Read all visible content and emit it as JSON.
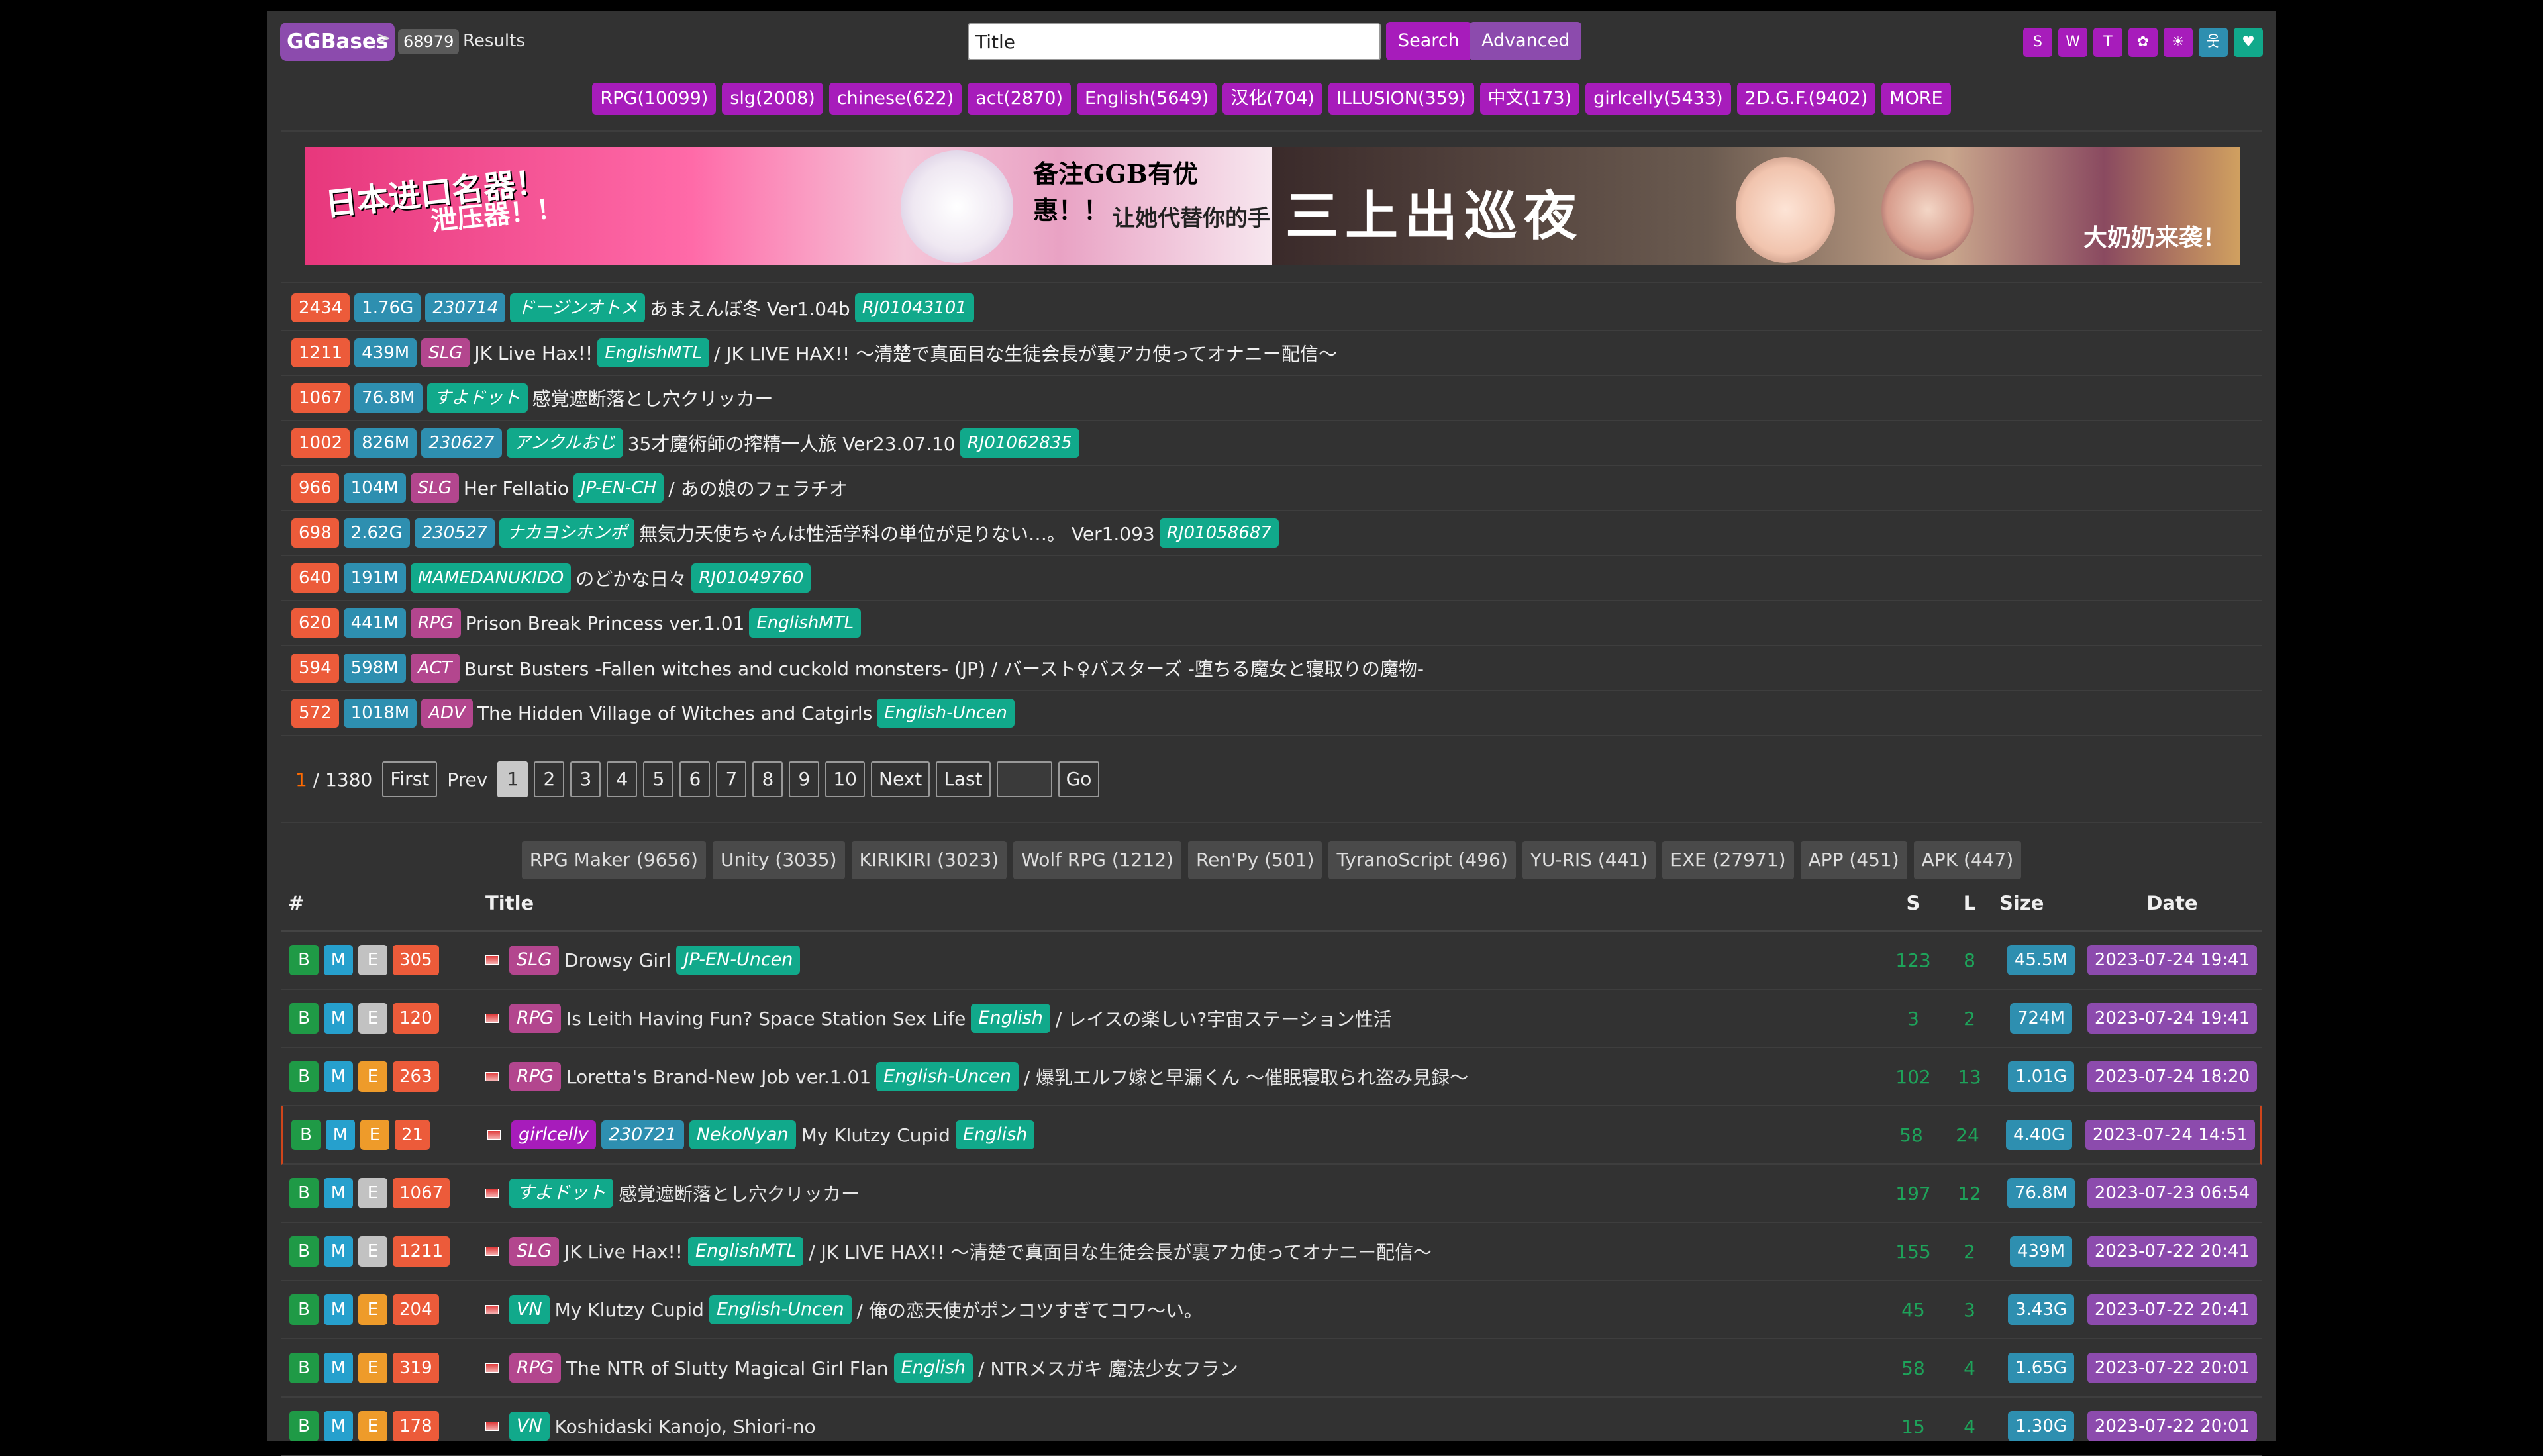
{
  "header": {
    "logo": "GGBases",
    "separator": ">",
    "count": "68979",
    "results_label": "Results",
    "search_value": "Title",
    "search_btn": "Search",
    "advanced_btn": "Advanced",
    "icons": [
      "S",
      "W",
      "T",
      "✿",
      "☀",
      "웃",
      "♥"
    ]
  },
  "categories": [
    "RPG(10099)",
    "slg(2008)",
    "chinese(622)",
    "act(2870)",
    "English(5649)",
    "汉化(704)",
    "ILLUSION(359)",
    "中文(173)",
    "girlcelly(5433)",
    "2D.G.F.(9402)",
    "MORE"
  ],
  "banner": {
    "left_line1": "日本进口名器！",
    "left_line2": "泄压器！！",
    "left_line3": "备注GGB有优惠！！",
    "left_line4": "让她代替你的手",
    "right_line1": "三上出巡夜",
    "right_line2": "大奶奶来袭！"
  },
  "top_list": [
    {
      "num": "2434",
      "size": "1.76G",
      "tags": [
        [
          "230714",
          "size"
        ],
        [
          "ドージンオトメ",
          "green"
        ]
      ],
      "title": "あまえんぼ冬 Ver1.04b",
      "tail": [
        [
          "RJ01043101",
          "green"
        ]
      ]
    },
    {
      "num": "1211",
      "size": "439M",
      "tags": [
        [
          "SLG",
          "pink"
        ]
      ],
      "title": "JK Live Hax!!",
      "mid": [
        [
          "EnglishMTL",
          "green"
        ]
      ],
      "title2": "/ JK LIVE HAX!! ～清楚で真面目な生徒会長が裏アカ使ってオナニー配信～",
      "tail": []
    },
    {
      "num": "1067",
      "size": "76.8M",
      "tags": [
        [
          "すよドット",
          "green"
        ]
      ],
      "title": "感覚遮断落とし穴クリッカー",
      "tail": []
    },
    {
      "num": "1002",
      "size": "826M",
      "tags": [
        [
          "230627",
          "size"
        ],
        [
          "アンクルおじ",
          "green"
        ]
      ],
      "title": "35才魔術師の搾精一人旅 Ver23.07.10",
      "tail": [
        [
          "RJ01062835",
          "green"
        ]
      ]
    },
    {
      "num": "966",
      "size": "104M",
      "tags": [
        [
          "SLG",
          "pink"
        ]
      ],
      "title": "Her Fellatio",
      "mid": [
        [
          "JP-EN-CH",
          "green"
        ]
      ],
      "title2": "/ あの娘のフェラチオ",
      "tail": []
    },
    {
      "num": "698",
      "size": "2.62G",
      "tags": [
        [
          "230527",
          "size"
        ],
        [
          "ナカヨシホンポ",
          "green"
        ]
      ],
      "title": "無気力天使ちゃんは性活学科の単位が足りない…。 Ver1.093",
      "tail": [
        [
          "RJ01058687",
          "green"
        ]
      ]
    },
    {
      "num": "640",
      "size": "191M",
      "tags": [
        [
          "MAMEDANUKIDO",
          "green"
        ]
      ],
      "title": "のどかな日々",
      "tail": [
        [
          "RJ01049760",
          "green"
        ]
      ]
    },
    {
      "num": "620",
      "size": "441M",
      "tags": [
        [
          "RPG",
          "pink"
        ]
      ],
      "title": "Prison Break Princess ver.1.01",
      "tail": [
        [
          "EnglishMTL",
          "green"
        ]
      ]
    },
    {
      "num": "594",
      "size": "598M",
      "tags": [
        [
          "ACT",
          "pink"
        ]
      ],
      "title": "Burst Busters -Fallen witches and cuckold monsters- (JP) / バースト♀バスターズ -堕ちる魔女と寝取りの魔物-",
      "tail": []
    },
    {
      "num": "572",
      "size": "1018M",
      "tags": [
        [
          "ADV",
          "pink"
        ]
      ],
      "title": "The Hidden Village of Witches and Catgirls",
      "tail": [
        [
          "English-Uncen",
          "green"
        ]
      ]
    }
  ],
  "pager": {
    "current": "1",
    "total": "/ 1380",
    "first": "First",
    "prev": "Prev",
    "pages": [
      "1",
      "2",
      "3",
      "4",
      "5",
      "6",
      "7",
      "8",
      "9",
      "10"
    ],
    "next": "Next",
    "last": "Last",
    "go": "Go"
  },
  "engines": [
    "RPG Maker (9656)",
    "Unity (3035)",
    "KIRIKIRI (3023)",
    "Wolf RPG (1212)",
    "Ren'Py (501)",
    "TyranoScript (496)",
    "YU-RIS (441)",
    "EXE (27971)",
    "APP (451)",
    "APK (447)"
  ],
  "table": {
    "headers": {
      "num": "#",
      "title": "Title",
      "s": "S",
      "l": "L",
      "size": "Size",
      "date": "Date"
    },
    "rows": [
      {
        "e": false,
        "num": "305",
        "tags": [
          [
            "SLG",
            "pink"
          ]
        ],
        "title": "Drowsy Girl",
        "mid": [
          [
            "JP-EN-Uncen",
            "green"
          ]
        ],
        "title2": "",
        "s": "123",
        "l": "8",
        "size": "45.5M",
        "date": "2023-07-24 19:41"
      },
      {
        "e": false,
        "num": "120",
        "tags": [
          [
            "RPG",
            "pink"
          ]
        ],
        "title": "Is Leith Having Fun? Space Station Sex Life",
        "mid": [
          [
            "English",
            "green"
          ]
        ],
        "title2": "/ レイスの楽しい?宇宙ステーション性活",
        "s": "3",
        "l": "2",
        "size": "724M",
        "date": "2023-07-24 19:41"
      },
      {
        "e": true,
        "num": "263",
        "tags": [
          [
            "RPG",
            "pink"
          ]
        ],
        "title": "Loretta's Brand-New Job ver.1.01",
        "mid": [
          [
            "English-Uncen",
            "green"
          ]
        ],
        "title2": "/ 爆乳エルフ嫁と早漏くん ～催眠寝取られ盗み見録～",
        "s": "102",
        "l": "13",
        "size": "1.01G",
        "date": "2023-07-24 18:20"
      },
      {
        "e": true,
        "num": "21",
        "tags": [
          [
            "girlcelly",
            "purple"
          ],
          [
            "230721",
            "size"
          ],
          [
            "NekoNyan",
            "green"
          ]
        ],
        "title": "My Klutzy Cupid",
        "mid": [
          [
            "English",
            "green"
          ]
        ],
        "title2": "",
        "s": "58",
        "l": "24",
        "size": "4.40G",
        "date": "2023-07-24 14:51",
        "sel": true
      },
      {
        "e": false,
        "num": "1067",
        "tags": [
          [
            "すよドット",
            "green"
          ]
        ],
        "title": "感覚遮断落とし穴クリッカー",
        "mid": [],
        "title2": "",
        "s": "197",
        "l": "12",
        "size": "76.8M",
        "date": "2023-07-23 06:54"
      },
      {
        "e": false,
        "num": "1211",
        "tags": [
          [
            "SLG",
            "pink"
          ]
        ],
        "title": "JK Live Hax!!",
        "mid": [
          [
            "EnglishMTL",
            "green"
          ]
        ],
        "title2": "/ JK LIVE HAX!! ～清楚で真面目な生徒会長が裏アカ使ってオナニー配信～",
        "s": "155",
        "l": "2",
        "size": "439M",
        "date": "2023-07-22 20:41"
      },
      {
        "e": true,
        "num": "204",
        "tags": [
          [
            "VN",
            "green"
          ]
        ],
        "title": "My Klutzy Cupid",
        "mid": [
          [
            "English-Uncen",
            "green"
          ]
        ],
        "title2": "/ 俺の恋天使がポンコツすぎてコワ～い。",
        "s": "45",
        "l": "3",
        "size": "3.43G",
        "date": "2023-07-22 20:41"
      },
      {
        "e": true,
        "num": "319",
        "tags": [
          [
            "RPG",
            "pink"
          ]
        ],
        "title": "The NTR of Slutty Magical Girl Flan",
        "mid": [
          [
            "English",
            "green"
          ]
        ],
        "title2": "/ NTRメスガキ 魔法少女フラン",
        "s": "58",
        "l": "4",
        "size": "1.65G",
        "date": "2023-07-22 20:01"
      },
      {
        "e": true,
        "num": "178",
        "tags": [
          [
            "VN",
            "green"
          ]
        ],
        "title": "Koshidaski Kanojo, Shiori-no",
        "mid": [],
        "title2": "",
        "s": "15",
        "l": "4",
        "size": "1.30G",
        "date": "2023-07-22 20:01"
      }
    ]
  },
  "colors": {
    "accent_purple": "#a71cbb",
    "brand": "#8c4bad",
    "tag_green": "#11a98b",
    "tag_pink": "#b3468e",
    "size_blue": "#2e8fb0",
    "num_orange": "#ec5b3a"
  }
}
